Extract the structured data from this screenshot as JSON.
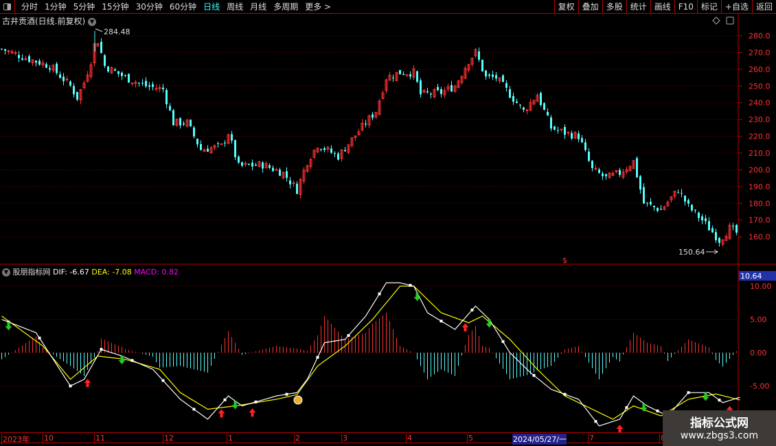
{
  "toolbar": {
    "tabs": [
      "分时",
      "1分钟",
      "5分钟",
      "15分钟",
      "30分钟",
      "60分钟",
      "日线",
      "周线",
      "月线",
      "多周期",
      "更多 >"
    ],
    "active": "日线",
    "right_buttons": [
      "复权",
      "叠加",
      "多股",
      "统计",
      "画线",
      "F10",
      "标记",
      "+自选",
      "返回"
    ]
  },
  "title": "古井贡酒(日线.前复权)",
  "price_labels": {
    "high": "284.48",
    "low": "150.64"
  },
  "indicator": {
    "name": "股朋指标网",
    "dif": "DIF: -6.67",
    "dea": "DEA: -7.08",
    "macd": "MACD: 0.82",
    "current_badge": "10.64"
  },
  "x_axis": [
    "2023年",
    "10",
    "11",
    "12",
    "1",
    "2",
    "3",
    "4",
    "5",
    "2024/05/27/一",
    "7",
    "8"
  ],
  "watermark": {
    "line1": "指标公式网",
    "line2": "www.zbgs3.com"
  },
  "colors": {
    "up": "#ff3232",
    "down": "#54ffff",
    "dif": "#ffffff",
    "dea": "#ffff00",
    "macd": "#ff00ff",
    "grid": "#8b0000"
  },
  "chart_data": [
    {
      "type": "candlestick",
      "title": "古井贡酒(日线.前复权)",
      "y_ticks": [
        "280.0",
        "270.0",
        "260.0",
        "250.0",
        "240.0",
        "230.0",
        "220.0",
        "210.0",
        "200.0",
        "190.0",
        "180.0",
        "170.0",
        "160.0"
      ],
      "ylim": [
        150,
        288
      ],
      "bars": 215,
      "close_path": [
        [
          0,
          272
        ],
        [
          8,
          266
        ],
        [
          14,
          262
        ],
        [
          20,
          250
        ],
        [
          22,
          243
        ],
        [
          24,
          252
        ],
        [
          26,
          265
        ],
        [
          27.6,
          280
        ],
        [
          30,
          262
        ],
        [
          36,
          255
        ],
        [
          42,
          250
        ],
        [
          47,
          248
        ],
        [
          50,
          228
        ],
        [
          54,
          228
        ],
        [
          58,
          212
        ],
        [
          64,
          214
        ],
        [
          66,
          222
        ],
        [
          69,
          202
        ],
        [
          76,
          203
        ],
        [
          82,
          198
        ],
        [
          86,
          188
        ],
        [
          89,
          205
        ],
        [
          92,
          215
        ],
        [
          98,
          208
        ],
        [
          102,
          218
        ],
        [
          106,
          228
        ],
        [
          109,
          235
        ],
        [
          112,
          255
        ],
        [
          116,
          258
        ],
        [
          120,
          258
        ],
        [
          122,
          245
        ],
        [
          128,
          246
        ],
        [
          132,
          250
        ],
        [
          136,
          265
        ],
        [
          138,
          270
        ],
        [
          141,
          255
        ],
        [
          144,
          255
        ],
        [
          148,
          245
        ],
        [
          152,
          235
        ],
        [
          156,
          245
        ],
        [
          160,
          225
        ],
        [
          164,
          222
        ],
        [
          168,
          220
        ],
        [
          172,
          200
        ],
        [
          176,
          195
        ],
        [
          180,
          198
        ],
        [
          184,
          205
        ],
        [
          187,
          180
        ],
        [
          192,
          176
        ],
        [
          197,
          188
        ],
        [
          200,
          178
        ],
        [
          204,
          170
        ],
        [
          209,
          158
        ],
        [
          212,
          165
        ],
        [
          215,
          161
        ]
      ]
    },
    {
      "type": "line+bar",
      "title": "MACD",
      "y_ticks": [
        "10.00",
        "5.00",
        "0.00",
        "-5.00"
      ],
      "ylim": [
        -12,
        11
      ],
      "dif": [
        [
          0,
          5
        ],
        [
          10,
          3
        ],
        [
          20,
          -5
        ],
        [
          24,
          -4
        ],
        [
          29,
          0.5
        ],
        [
          35,
          -0.5
        ],
        [
          44,
          -2.5
        ],
        [
          52,
          -7
        ],
        [
          60,
          -10
        ],
        [
          66,
          -6.5
        ],
        [
          70,
          -8
        ],
        [
          80,
          -6.5
        ],
        [
          86,
          -6
        ],
        [
          89,
          -4
        ],
        [
          94,
          1.5
        ],
        [
          100,
          2
        ],
        [
          106,
          5.5
        ],
        [
          112,
          10.5
        ],
        [
          116,
          10.5
        ],
        [
          120,
          10
        ],
        [
          124,
          6
        ],
        [
          132,
          3.5
        ],
        [
          138,
          7
        ],
        [
          142,
          5
        ],
        [
          148,
          0
        ],
        [
          154,
          -3
        ],
        [
          160,
          -5.5
        ],
        [
          168,
          -7
        ],
        [
          174,
          -11
        ],
        [
          180,
          -10
        ],
        [
          184,
          -6.5
        ],
        [
          188,
          -8
        ],
        [
          194,
          -9.5
        ],
        [
          200,
          -6
        ],
        [
          206,
          -6
        ],
        [
          210,
          -7.5
        ],
        [
          215,
          -6.7
        ]
      ],
      "dea": [
        [
          0,
          5.5
        ],
        [
          12,
          1
        ],
        [
          20,
          -4
        ],
        [
          28,
          -0.5
        ],
        [
          36,
          -1
        ],
        [
          46,
          -2.5
        ],
        [
          52,
          -6
        ],
        [
          60,
          -8.5
        ],
        [
          68,
          -8
        ],
        [
          80,
          -7
        ],
        [
          86,
          -6.3
        ],
        [
          92,
          -2
        ],
        [
          100,
          1
        ],
        [
          108,
          5
        ],
        [
          116,
          10
        ],
        [
          120,
          10
        ],
        [
          128,
          6
        ],
        [
          136,
          4.5
        ],
        [
          140,
          5.5
        ],
        [
          148,
          2
        ],
        [
          156,
          -2.5
        ],
        [
          164,
          -6.5
        ],
        [
          172,
          -8.5
        ],
        [
          178,
          -10
        ],
        [
          184,
          -8
        ],
        [
          192,
          -9.5
        ],
        [
          200,
          -7
        ],
        [
          208,
          -6.2
        ],
        [
          215,
          -7.1
        ]
      ],
      "buy_signals": [
        25,
        64,
        73,
        135,
        180,
        212
      ],
      "sell_signals": [
        2,
        35,
        68,
        121,
        142,
        187,
        205
      ]
    }
  ]
}
